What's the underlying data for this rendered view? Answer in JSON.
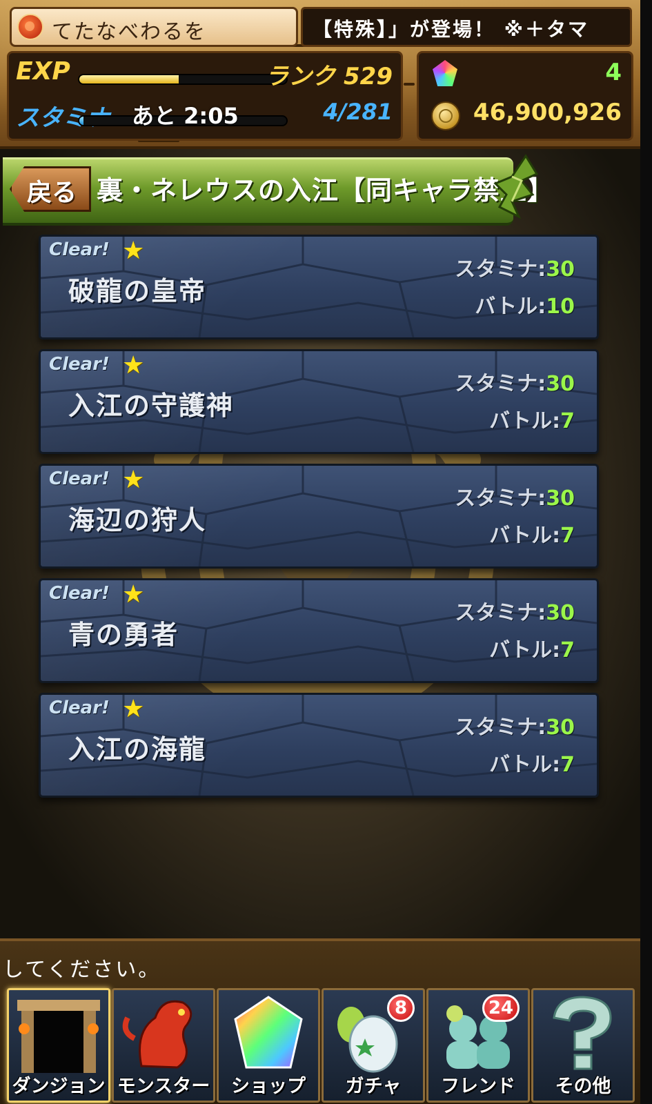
{
  "player": {
    "name": "てたなべわるを",
    "exp_label": "EXP",
    "exp_progress": 0.48,
    "rank": "ランク 529",
    "stamina_label": "スタミナ",
    "stamina_progress": 0.02,
    "stamina_timer": "あと 2:05",
    "stamina_value": "4/281",
    "magic_stones": "4",
    "coins": "46,900,926"
  },
  "ticker": {
    "text": "【特殊】」が登場！ ※＋タマ"
  },
  "header": {
    "back_label": "戻る",
    "dungeon_title": "裏・ネレウスの入江【同キャラ禁止】"
  },
  "floors": [
    {
      "clear": "Clear!",
      "name": "破龍の皇帝",
      "stamina_label": "スタミナ:",
      "stamina": "30",
      "battle_label": "バトル:",
      "battle": "10"
    },
    {
      "clear": "Clear!",
      "name": "入江の守護神",
      "stamina_label": "スタミナ:",
      "stamina": "30",
      "battle_label": "バトル:",
      "battle": "7"
    },
    {
      "clear": "Clear!",
      "name": "海辺の狩人",
      "stamina_label": "スタミナ:",
      "stamina": "30",
      "battle_label": "バトル:",
      "battle": "7"
    },
    {
      "clear": "Clear!",
      "name": "青の勇者",
      "stamina_label": "スタミナ:",
      "stamina": "30",
      "battle_label": "バトル:",
      "battle": "7"
    },
    {
      "clear": "Clear!",
      "name": "入江の海龍",
      "stamina_label": "スタミナ:",
      "stamina": "30",
      "battle_label": "バトル:",
      "battle": "7"
    }
  ],
  "bottom": {
    "message": "してください。"
  },
  "nav": [
    {
      "label": "ダンジョン",
      "icon": "dungeon-gate-icon",
      "active": true
    },
    {
      "label": "モンスター",
      "icon": "red-dragon-icon"
    },
    {
      "label": "ショップ",
      "icon": "rainbow-stone-icon"
    },
    {
      "label": "ガチャ",
      "icon": "egg-icon",
      "badge": "8"
    },
    {
      "label": "フレンド",
      "icon": "friends-icon",
      "badge": "24"
    },
    {
      "label": "その他",
      "icon": "question-icon"
    }
  ],
  "colors": {
    "accent_green": "#9bf64a",
    "stamina_blue": "#49b4ff",
    "gold": "#ffd54a",
    "floor_blue": "#2e3f5f"
  }
}
